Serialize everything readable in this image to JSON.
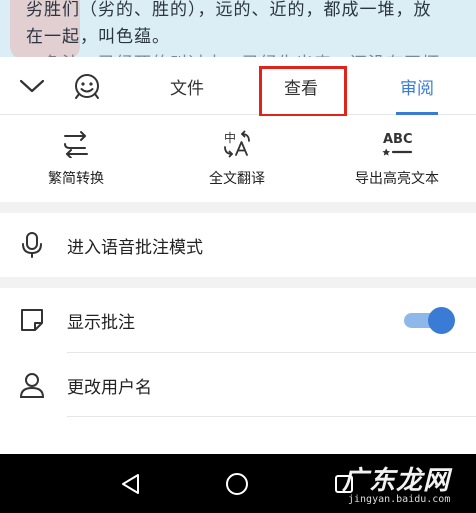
{
  "document": {
    "line1": "劣胜们（劣的、胜的），远的、近的，都成一堆，放",
    "line2": "在一起，叫色蕴。",
    "line3": "　色法，已经死的叫过去，已经生出来，还没有正坏"
  },
  "toolbar": {
    "collapse_icon": "chevron-down-icon",
    "emoji_icon": "smiley-icon",
    "tabs": [
      {
        "label": "文件"
      },
      {
        "label": "查看"
      },
      {
        "label": "审阅"
      }
    ],
    "active_tab": "审阅",
    "highlight_color": "#e0231b"
  },
  "tools": [
    {
      "label": "繁简转换",
      "icon": "convert-arrows-icon"
    },
    {
      "label": "全文翻译",
      "icon": "translate-icon"
    },
    {
      "label": "导出高亮文本",
      "icon": "abc-highlight-icon"
    }
  ],
  "rows": {
    "voice": {
      "label": "进入语音批注模式",
      "icon": "microphone-icon"
    },
    "show_comments": {
      "label": "显示批注",
      "icon": "note-icon",
      "toggle_on": true
    },
    "username": {
      "label": "更改用户名",
      "icon": "user-icon"
    }
  },
  "navbar": {
    "back_icon": "back-triangle-icon",
    "home_icon": "home-circle-icon",
    "recent_icon": "recent-square-icon"
  },
  "watermark": {
    "main": "广东龙网",
    "sub": "jingyan.baidu.com"
  },
  "colors": {
    "accent": "#3a7bd5",
    "toggle_track": "#8fb8ea",
    "section_gap": "#f2f2f2",
    "nav_bg": "#000000"
  }
}
